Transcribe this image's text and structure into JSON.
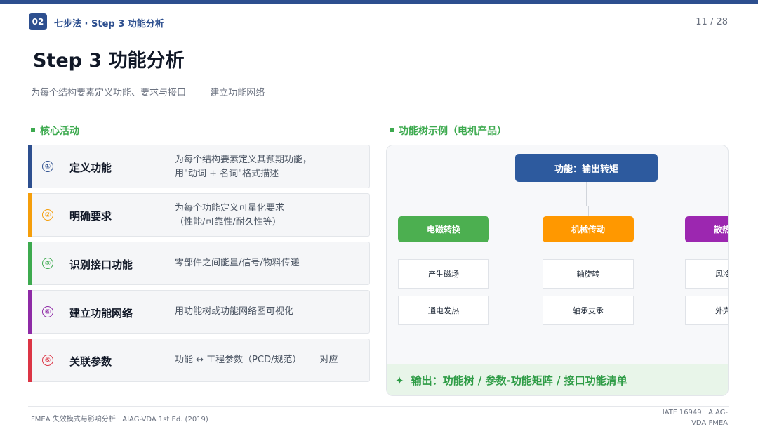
{
  "header": {
    "section_badge": "02",
    "section_title": "七步法 · Step 3 功能分析",
    "page_number": "11 / 28"
  },
  "title": "Step 3 功能分析",
  "subtitle": "为每个结构要素定义功能、要求与接口 —— 建立功能网络",
  "left_heading": "核心活动",
  "steps": [
    {
      "num": "①",
      "label": "定义功能",
      "desc_line1": "为每个结构要素定义其预期功能，",
      "desc_line2": "用\"动词 + 名词\"格式描述",
      "color": "#2d4f8f"
    },
    {
      "num": "②",
      "label": "明确要求",
      "desc_line1": "为每个功能定义可量化要求",
      "desc_line2": "（性能/可靠性/耐久性等）",
      "color": "#f59e0b"
    },
    {
      "num": "③",
      "label": "识别接口功能",
      "desc_line1": "零部件之间能量/信号/物料传递",
      "desc_line2": "",
      "color": "#3daa4f"
    },
    {
      "num": "④",
      "label": "建立功能网络",
      "desc_line1": "用功能树或功能网络图可视化",
      "desc_line2": "",
      "color": "#8e2aa6"
    },
    {
      "num": "⑤",
      "label": "关联参数",
      "desc_line1": "功能 ↔ 工程参数（PCD/规范）——对应",
      "desc_line2": "",
      "color": "#dc3545"
    }
  ],
  "right_heading": "功能树示例（电机产品）",
  "tree": {
    "root": "功能：输出转矩",
    "branches": [
      {
        "label": "电磁转换",
        "color": "#4caf50",
        "leaves": [
          "产生磁场",
          "通电发热"
        ]
      },
      {
        "label": "机械传动",
        "color": "#ff9800",
        "leaves": [
          "轴旋转",
          "轴承支承"
        ]
      },
      {
        "label": "散热保护",
        "color": "#9c27b0",
        "leaves": [
          "风冷散热",
          "外壳防护"
        ]
      }
    ],
    "output_icon": "sparkle-icon",
    "output": "输出：功能树 / 参数-功能矩阵 / 接口功能清单"
  },
  "footer": {
    "left": "FMEA 失效模式与影响分析 · AIAG-VDA 1st Ed. (2019)",
    "right_line1": "IATF 16949 · AIAG-",
    "right_line2": "VDA FMEA"
  }
}
